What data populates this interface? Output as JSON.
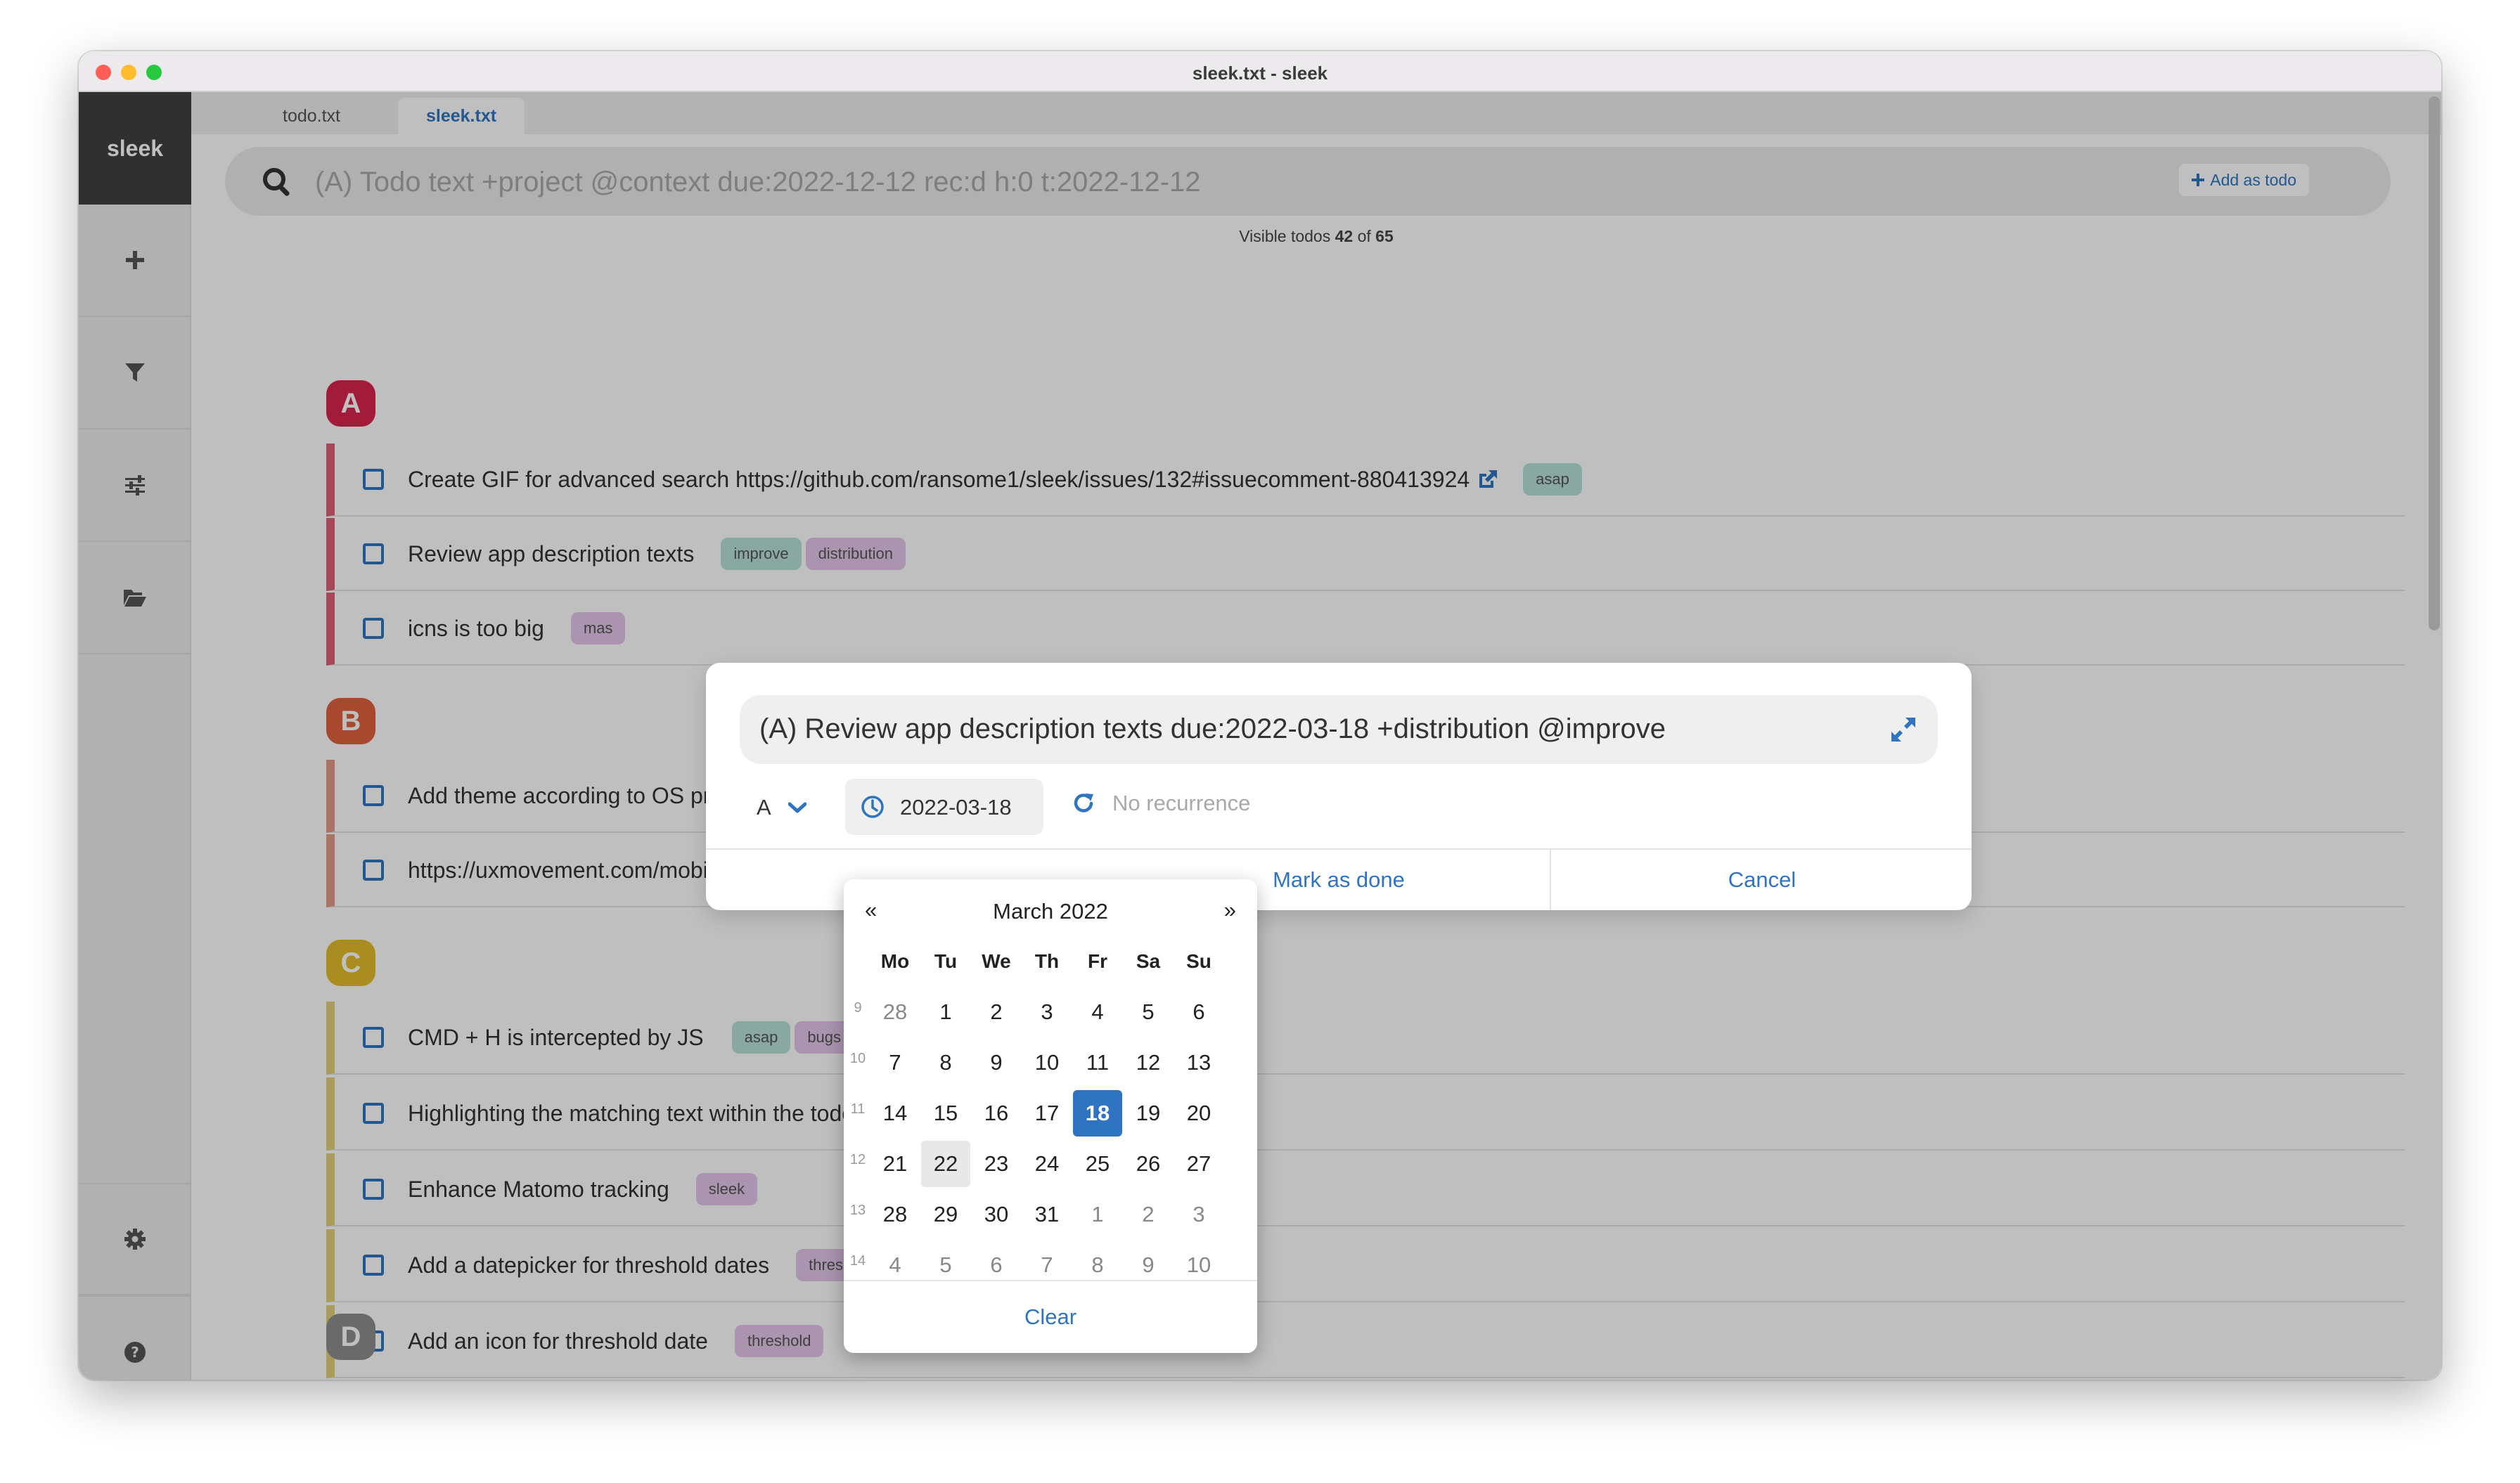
{
  "window": {
    "title": "sleek.txt - sleek",
    "traffic_lights": [
      "#ff5f57",
      "#febc2e",
      "#28c840"
    ]
  },
  "sidebar": {
    "brand": "sleek",
    "icons": [
      "plus-icon",
      "filter-icon",
      "sliders-icon",
      "folder-open-icon",
      "gear-icon",
      "question-circle-icon"
    ]
  },
  "tabs": [
    {
      "label": "todo.txt",
      "active": false
    },
    {
      "label": "sleek.txt",
      "active": true
    }
  ],
  "search": {
    "placeholder": "(A) Todo text +project @context due:2022-12-12 rec:d h:0 t:2022-12-12",
    "add_button": "Add as todo"
  },
  "visible": {
    "prefix": "Visible todos",
    "count": "42",
    "of": "of",
    "total": "65"
  },
  "groups": [
    {
      "priority": "A",
      "color": "#d9244b",
      "bar": "#dd5f73",
      "items": [
        {
          "text": "Create GIF for advanced search https://github.com/ransome1/sleek/issues/132#issuecomment-880413924",
          "link": true,
          "tags": [
            {
              "label": "asap",
              "kind": "green"
            }
          ]
        },
        {
          "text": "Review app description texts",
          "link": false,
          "tags": [
            {
              "label": "improve",
              "kind": "green"
            },
            {
              "label": "distribution",
              "kind": "purple"
            }
          ]
        },
        {
          "text": "icns is too big",
          "link": false,
          "tags": [
            {
              "label": "mas",
              "kind": "purple"
            }
          ]
        }
      ]
    },
    {
      "priority": "B",
      "color": "#e1603f",
      "bar": "#e59a86",
      "items": [
        {
          "text": "Add theme according to OS pr",
          "link": false,
          "tags": []
        },
        {
          "text": "https://uxmovement.com/mobil",
          "link": false,
          "tags": []
        }
      ]
    },
    {
      "priority": "C",
      "color": "#e3bd2c",
      "bar": "#e3d17a",
      "items": [
        {
          "text": "CMD + H is intercepted by JS",
          "link": false,
          "tags": [
            {
              "label": "asap",
              "kind": "green"
            },
            {
              "label": "bugs",
              "kind": "purple"
            }
          ]
        },
        {
          "text": "Highlighting the matching text within the todo",
          "link": false,
          "tags": []
        },
        {
          "text": "Enhance Matomo tracking",
          "link": false,
          "tags": [
            {
              "label": "sleek",
              "kind": "purple"
            }
          ]
        },
        {
          "text": "Add a datepicker for threshold dates",
          "link": false,
          "tags": [
            {
              "label": "thresh",
              "kind": "purple"
            }
          ]
        },
        {
          "text": "Add an icon for threshold date",
          "link": false,
          "tags": [
            {
              "label": "threshold",
              "kind": "purple"
            }
          ]
        }
      ]
    },
    {
      "priority": "D",
      "color": "#8e8e8e",
      "bar": "#bdbdbd",
      "items": []
    }
  ],
  "modal": {
    "input_value": "(A) Review app description texts due:2022-03-18 +distribution @improve",
    "priority": "A",
    "due_date": "2022-03-18",
    "recurrence": "No recurrence",
    "mark_done": "Mark as done",
    "cancel": "Cancel"
  },
  "calendar": {
    "title": "March 2022",
    "prev": "«",
    "next": "»",
    "weekdays": [
      "Mo",
      "Tu",
      "We",
      "Th",
      "Fr",
      "Sa",
      "Su"
    ],
    "weeks": [
      {
        "week": "9",
        "days": [
          "28",
          "1",
          "2",
          "3",
          "4",
          "5",
          "6"
        ]
      },
      {
        "week": "10",
        "days": [
          "7",
          "8",
          "9",
          "10",
          "11",
          "12",
          "13"
        ]
      },
      {
        "week": "11",
        "days": [
          "14",
          "15",
          "16",
          "17",
          "18",
          "19",
          "20"
        ]
      },
      {
        "week": "12",
        "days": [
          "21",
          "22",
          "23",
          "24",
          "25",
          "26",
          "27"
        ]
      },
      {
        "week": "13",
        "days": [
          "28",
          "29",
          "30",
          "31",
          "1",
          "2",
          "3"
        ]
      },
      {
        "week": "14",
        "days": [
          "4",
          "5",
          "6",
          "7",
          "8",
          "9",
          "10"
        ]
      }
    ],
    "selected": "18",
    "hovered": "22",
    "clear": "Clear"
  },
  "accent": "#2f74c0"
}
